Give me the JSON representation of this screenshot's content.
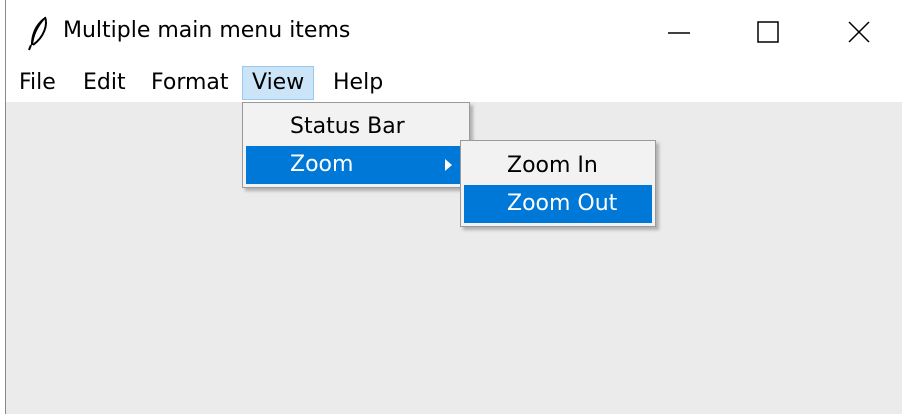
{
  "window": {
    "title": "Multiple main menu items",
    "app_icon": "feather-icon",
    "controls": {
      "minimize_icon": "minimize-icon",
      "maximize_icon": "maximize-icon",
      "close_icon": "close-icon"
    }
  },
  "menubar": {
    "items": [
      {
        "label": "File"
      },
      {
        "label": "Edit"
      },
      {
        "label": "Format"
      },
      {
        "label": "View",
        "active": true
      },
      {
        "label": "Help"
      }
    ]
  },
  "view_menu": {
    "items": [
      {
        "label": "Status Bar"
      },
      {
        "label": "Zoom",
        "submenu": true,
        "selected": true,
        "arrow_icon": "chevron-right-icon"
      }
    ]
  },
  "zoom_submenu": {
    "items": [
      {
        "label": "Zoom In"
      },
      {
        "label": "Zoom Out",
        "selected": true
      }
    ]
  },
  "colors": {
    "selection": "#0078d7",
    "active_menu_bg": "#cce4f7",
    "client_bg": "#ebebeb"
  }
}
